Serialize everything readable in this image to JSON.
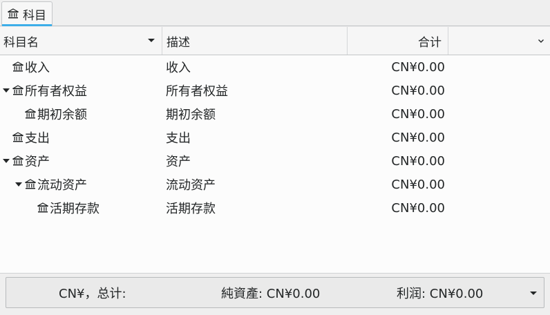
{
  "tab": {
    "label": "科目",
    "icon": "bank-icon"
  },
  "columns": {
    "name": "科目名",
    "description": "描述",
    "total": "合计"
  },
  "accounts": [
    {
      "name": "收入",
      "description": "收入",
      "total": "CN¥0.00",
      "depth": 0,
      "expanded": false,
      "has_children": false
    },
    {
      "name": "所有者权益",
      "description": "所有者权益",
      "total": "CN¥0.00",
      "depth": 0,
      "expanded": true,
      "has_children": true
    },
    {
      "name": "期初余额",
      "description": "期初余额",
      "total": "CN¥0.00",
      "depth": 1,
      "expanded": false,
      "has_children": false
    },
    {
      "name": "支出",
      "description": "支出",
      "total": "CN¥0.00",
      "depth": 0,
      "expanded": false,
      "has_children": false
    },
    {
      "name": "资产",
      "description": "资产",
      "total": "CN¥0.00",
      "depth": 0,
      "expanded": true,
      "has_children": true
    },
    {
      "name": "流动资产",
      "description": "流动资产",
      "total": "CN¥0.00",
      "depth": 1,
      "expanded": true,
      "has_children": true
    },
    {
      "name": "活期存款",
      "description": "活期存款",
      "total": "CN¥0.00",
      "depth": 2,
      "expanded": false,
      "has_children": false
    }
  ],
  "summary": {
    "currency_total": "CN¥，总计:",
    "net_assets": "純資產: CN¥0.00",
    "profit": "利润:  CN¥0.00"
  },
  "colors": {
    "accent": "#3daee9",
    "text": "#232627",
    "background": "#fcfcfc"
  }
}
